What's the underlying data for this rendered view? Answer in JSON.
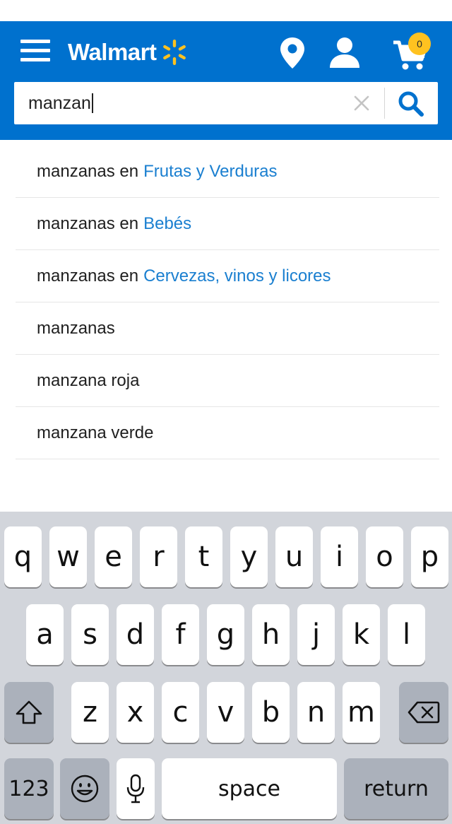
{
  "header": {
    "brand": "Walmart",
    "cart_count": "0",
    "colors": {
      "bar": "#0071ce",
      "spark": "#ffc220"
    }
  },
  "search": {
    "value": "manzan"
  },
  "suggestions": [
    {
      "text": "manzanas en",
      "category": "Frutas y Verduras"
    },
    {
      "text": "manzanas en",
      "category": "Bebés"
    },
    {
      "text": "manzanas en",
      "category": "Cervezas, vinos y licores"
    },
    {
      "text": "manzanas",
      "category": ""
    },
    {
      "text": "manzana roja",
      "category": ""
    },
    {
      "text": "manzana verde",
      "category": ""
    }
  ],
  "keyboard": {
    "row1": [
      "q",
      "w",
      "e",
      "r",
      "t",
      "y",
      "u",
      "i",
      "o",
      "p"
    ],
    "row2": [
      "a",
      "s",
      "d",
      "f",
      "g",
      "h",
      "j",
      "k",
      "l"
    ],
    "row3": [
      "z",
      "x",
      "c",
      "v",
      "b",
      "n",
      "m"
    ],
    "numbers": "123",
    "space": "space",
    "return": "return",
    "icons": {
      "shift": "shift-icon",
      "backspace": "backspace-icon",
      "emoji": "emoji-icon",
      "mic": "microphone-icon"
    }
  }
}
